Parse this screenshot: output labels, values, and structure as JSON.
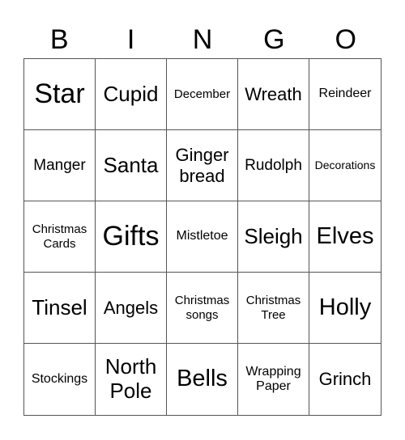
{
  "header": [
    "B",
    "I",
    "N",
    "G",
    "O"
  ],
  "cells": [
    "Star",
    "Cupid",
    "December",
    "Wreath",
    "Reindeer",
    "Manger",
    "Santa",
    "Ginger bread",
    "Rudolph",
    "Decorations",
    "Christmas Cards",
    "Gifts",
    "Mistletoe",
    "Sleigh",
    "Elves",
    "Tinsel",
    "Angels",
    "Christmas songs",
    "Christmas Tree",
    "Holly",
    "Stockings",
    "North Pole",
    "Bells",
    "Wrapping Paper",
    "Grinch"
  ]
}
